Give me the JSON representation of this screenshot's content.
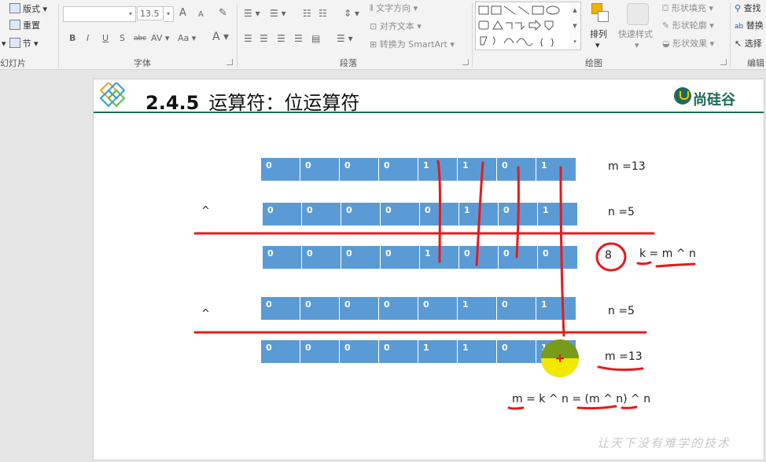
{
  "ribbon": {
    "slides_group": {
      "label": "幻灯片",
      "layout": "版式",
      "reset": "重置",
      "section": "节"
    },
    "font_group": {
      "label": "字体",
      "font_size": "13.5",
      "bold": "B",
      "italic": "I",
      "underline": "U",
      "shadow": "S",
      "strikethrough": "abc",
      "spacing": "AV",
      "change_case": "Aa",
      "grow": "A",
      "shrink": "A",
      "font_color": "A"
    },
    "paragraph_group": {
      "label": "段落",
      "text_direction": "文字方向",
      "align_text": "对齐文本",
      "convert_smartart": "转换为 SmartArt"
    },
    "drawing_group": {
      "label": "绘图",
      "arrange": "排列",
      "quick_styles": "快速样式",
      "shape_fill": "形状填充",
      "shape_outline": "形状轮廓",
      "shape_effects": "形状效果"
    },
    "editing_group": {
      "label": "编辑",
      "find": "查找",
      "replace": "替换",
      "select": "选择"
    }
  },
  "slide": {
    "title_number": "2.4.5",
    "title_text": "运算符：位运算符",
    "logo_text": "尚硅谷",
    "watermark": "让天下没有难学的技术",
    "rows": [
      {
        "bits": [
          "0",
          "0",
          "0",
          "0",
          "1",
          "1",
          "0",
          "1"
        ],
        "label": "m =13",
        "op": ""
      },
      {
        "bits": [
          "0",
          "0",
          "0",
          "0",
          "0",
          "1",
          "0",
          "1"
        ],
        "label": "n =5",
        "op": "^"
      },
      {
        "bits": [
          "0",
          "0",
          "0",
          "0",
          "1",
          "0",
          "0",
          "0"
        ],
        "label": "k = m ^ n",
        "op": "",
        "circled": "8"
      },
      {
        "bits": [
          "0",
          "0",
          "0",
          "0",
          "0",
          "1",
          "0",
          "1"
        ],
        "label": "n =5",
        "op": "^"
      },
      {
        "bits": [
          "0",
          "0",
          "0",
          "0",
          "1",
          "1",
          "0",
          "1"
        ],
        "label": "m =13",
        "op": ""
      }
    ],
    "formula": "m = k ^ n = (m ^ n) ^ n"
  },
  "colors": {
    "bit_fill": "#5b9bd5",
    "annotation_red": "#e8191b",
    "brand_green": "#1f6b57",
    "highlight_yellow": "#f5e800",
    "highlight_olive": "#7a9a1a"
  }
}
